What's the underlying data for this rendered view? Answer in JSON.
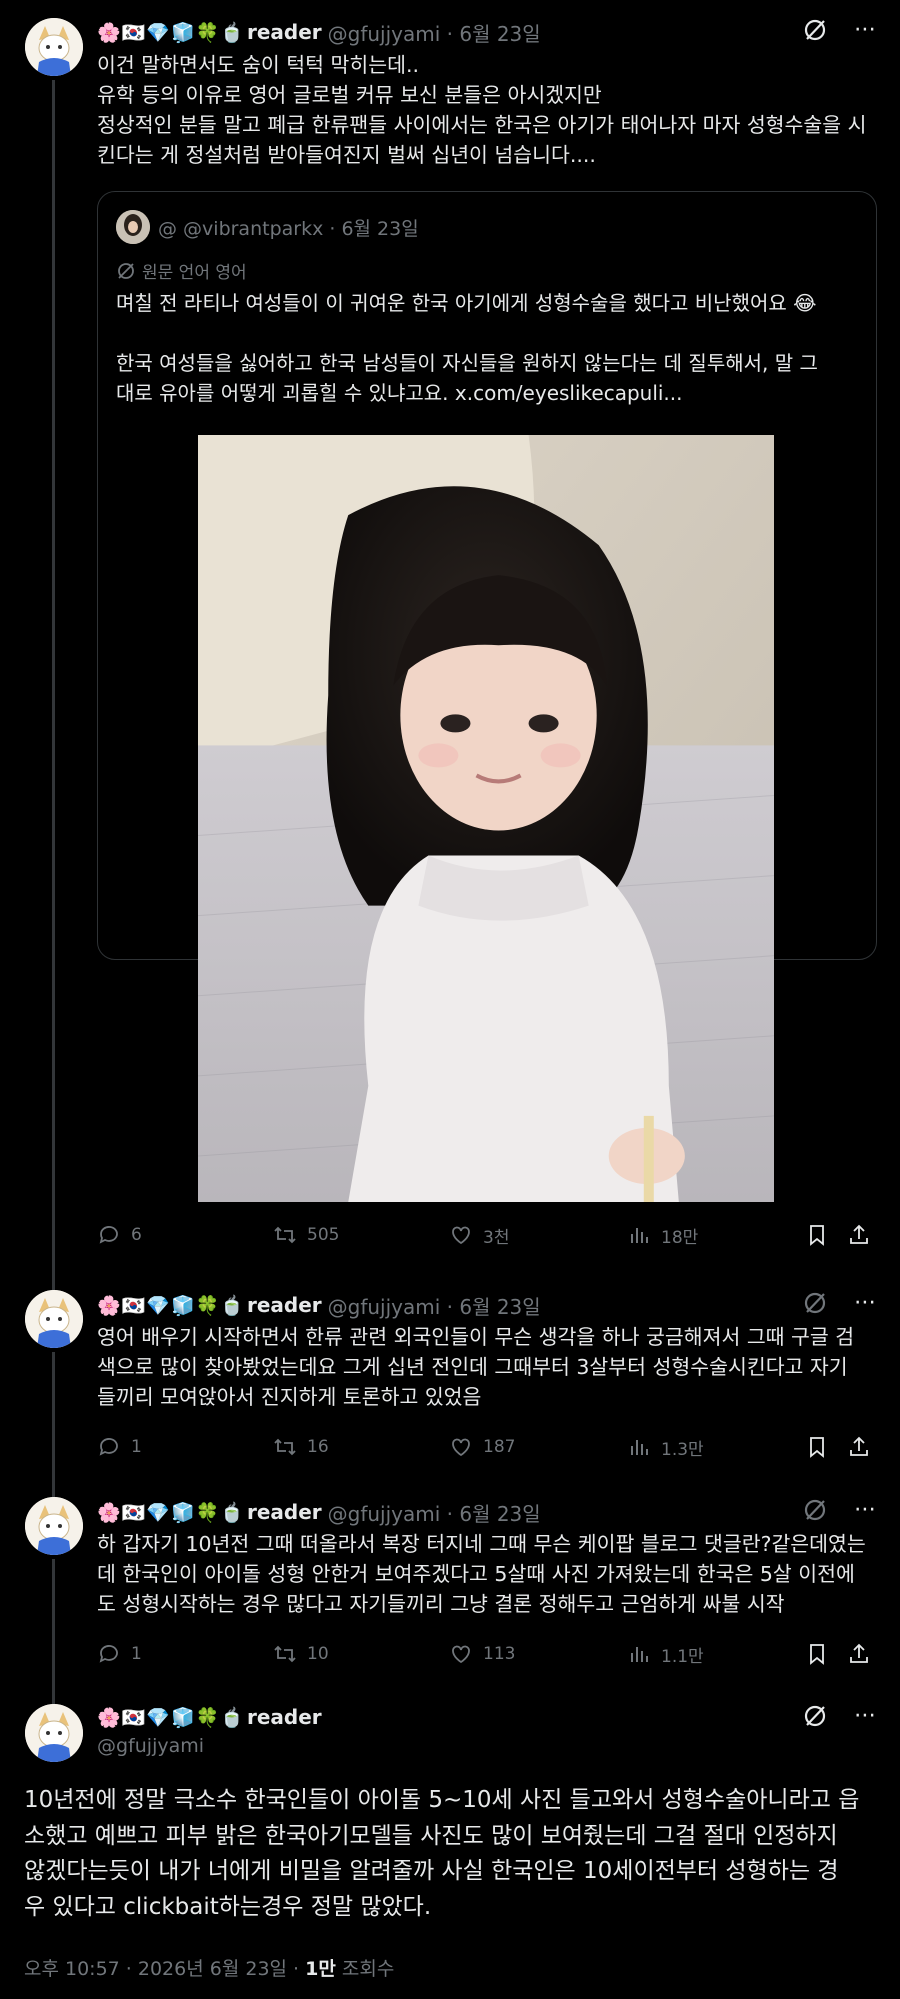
{
  "author": {
    "emojis": "🌸🇰🇷💎🧊🍀🍵",
    "name": "reader",
    "handle": "@gfujjyami"
  },
  "tweets": [
    {
      "meta": "@gfujjyami · 6월 23일",
      "text": "이건 말하면서도 숨이 턱턱 막히는데..\n유학 등의 이유로 영어 글로벌 커뮤 보신 분들은 아시겠지만\n정상적인 분들 말고 폐급 한류팬들 사이에서는 한국은 아기가 태어나자 마자 성형수술을 시\n킨다는 게 정설처럼 받아들여진지 벌써 십년이 넘습니다....",
      "replies": "6",
      "retweets": "505",
      "likes": "3천",
      "views": "18만"
    },
    {
      "meta": "@gfujjyami · 6월 23일",
      "text": "영어 배우기 시작하면서 한류 관련 외국인들이 무슨 생각을 하나 궁금해져서 그때 구글 검\n색으로 많이 찾아봤었는데요 그게 십년 전인데 그때부터 3살부터 성형수술시킨다고 자기\n들끼리 모여앉아서 진지하게 토론하고 있었음",
      "replies": "1",
      "retweets": "16",
      "likes": "187",
      "views": "1.3만"
    },
    {
      "meta": "@gfujjyami · 6월 23일",
      "text": "하 갑자기 10년전 그때 떠올라서 복장 터지네 그때 무슨 케이팝 블로그 댓글란?같은데였는\n데 한국인이 아이돌 성형 안한거 보여주겠다고 5살때 사진 가져왔는데 한국은 5살 이전에\n도 성형시작하는 경우 많다고 자기들끼리 그냥 결론 정해두고 근엄하게 싸불 시작",
      "replies": "1",
      "retweets": "10",
      "likes": "113",
      "views": "1.1만"
    }
  ],
  "quote": {
    "handle": "@ @vibrantparkx · 6월 23일",
    "translate_label": "원문 언어 영어",
    "text": "며칠 전 라티나 여성들이 이 귀여운 한국 아기에게 성형수술을 했다고 비난했어요 😂\n\n한국 여성들을 싫어하고 한국 남성들이 자신들을 원하지 않는다는 데 질투해서, 말 그\n대로 유아를 어떻게 괴롭힐 수 있냐고요. x.com/eyeslikecapuli..."
  },
  "main": {
    "text": "10년전에 정말 극소수 한국인들이 아이돌 5~10세 사진 들고와서 성형수술아니라고 읍\n소했고 예쁘고 피부 밝은 한국아기모델들 사진도 많이 보여줬는데 그걸 절대 인정하지\n않겠다는듯이 내가 너에게 비밀을 알려줄까 사실 한국인은 10세이전부터 성형하는 경\n우 있다고 clickbait하는경우 정말 많았다.",
    "time": "오후 10:57 · 2026년 6월 23일 · ",
    "views_count": "1만",
    "views_label": " 조회수"
  },
  "icons": [
    "grok-icon",
    "more-icon",
    "reply-icon",
    "retweet-icon",
    "like-icon",
    "views-icon",
    "bookmark-icon",
    "share-icon",
    "translate-icon"
  ]
}
